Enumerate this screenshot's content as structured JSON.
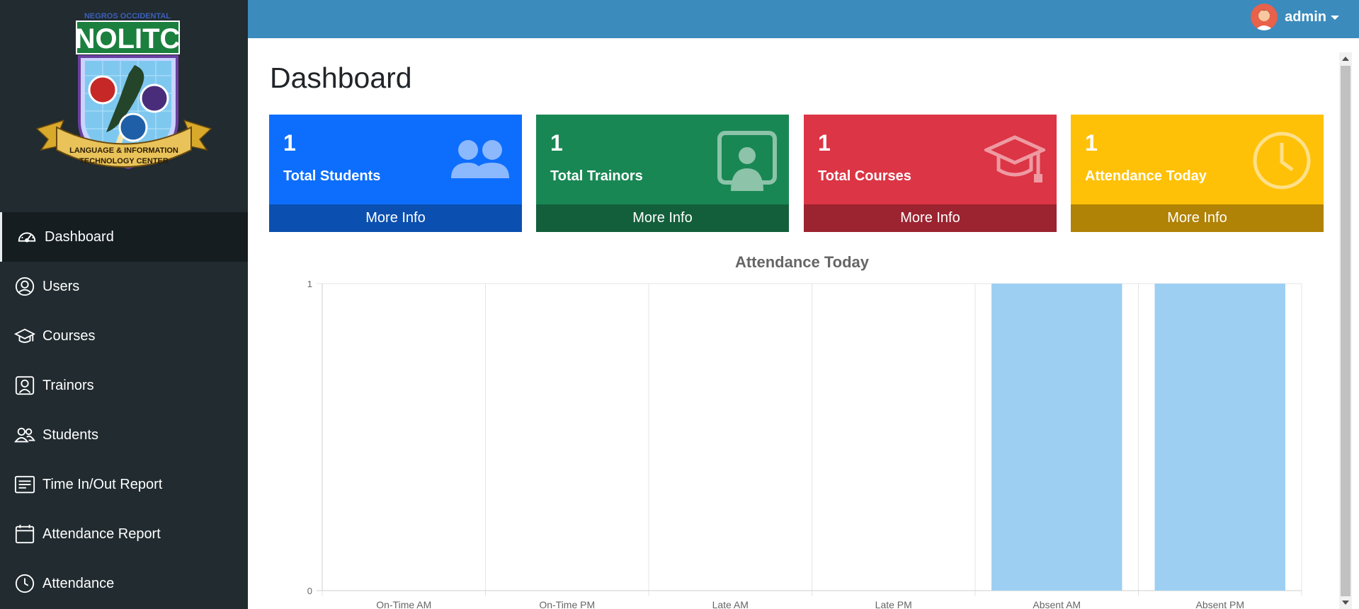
{
  "sidebar": {
    "logo": {
      "top_text": "NEGROS OCCIDENTAL",
      "brand": "NOLITC",
      "ribbon_line1": "LANGUAGE & INFORMATION",
      "ribbon_line2": "TECHNOLOGY CENTER"
    },
    "items": [
      {
        "label": "Dashboard",
        "icon": "speedometer-icon",
        "active": true
      },
      {
        "label": "Users",
        "icon": "person-circle-icon"
      },
      {
        "label": "Courses",
        "icon": "mortarboard-icon"
      },
      {
        "label": "Trainors",
        "icon": "person-square-icon"
      },
      {
        "label": "Students",
        "icon": "people-icon"
      },
      {
        "label": "Time In/Out Report",
        "icon": "card-text-icon"
      },
      {
        "label": "Attendance Report",
        "icon": "calendar-icon"
      },
      {
        "label": "Attendance",
        "icon": "clock-icon"
      }
    ]
  },
  "header": {
    "user_name": "admin",
    "accent_color": "#3b8bbd"
  },
  "main": {
    "title": "Dashboard",
    "cards": [
      {
        "count": "1",
        "label": "Total Students",
        "footer": "More Info",
        "icon": "people-fill-icon",
        "color": "#0d6efd"
      },
      {
        "count": "1",
        "label": "Total Trainors",
        "footer": "More Info",
        "icon": "person-video-icon",
        "color": "#198754"
      },
      {
        "count": "1",
        "label": "Total Courses",
        "footer": "More Info",
        "icon": "mortarboard-icon",
        "color": "#dc3545"
      },
      {
        "count": "1",
        "label": "Attendance Today",
        "footer": "More Info",
        "icon": "clock-icon",
        "color": "#ffc107"
      }
    ]
  },
  "chart_data": {
    "type": "bar",
    "title": "Attendance Today",
    "categories": [
      "On-Time AM",
      "On-Time PM",
      "Late AM",
      "Late PM",
      "Absent AM",
      "Absent PM"
    ],
    "values": [
      0,
      0,
      0,
      0,
      1,
      1
    ],
    "ylim": [
      0,
      1
    ],
    "yticks": [
      "0",
      "1"
    ],
    "bar_color": "#9dcff2",
    "grid": true
  }
}
